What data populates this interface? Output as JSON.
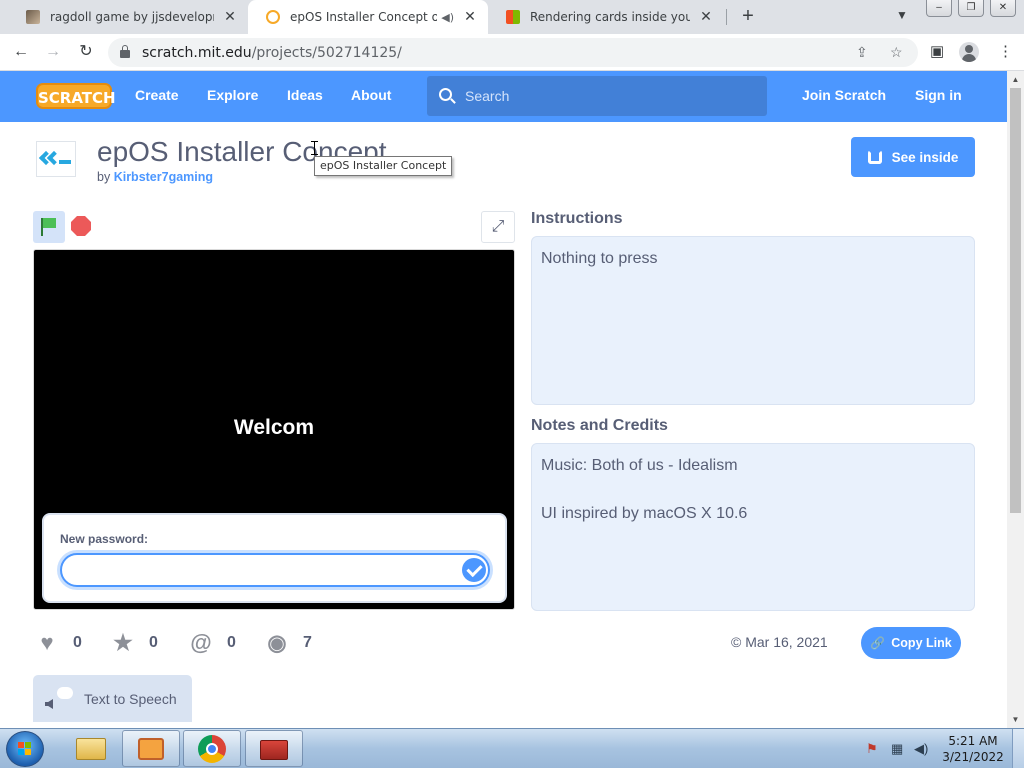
{
  "browser": {
    "tabs": [
      {
        "title": "ragdoll game by jjsdevelopments",
        "active": false
      },
      {
        "title": "epOS Installer Concept on Scratch",
        "active": true
      },
      {
        "title": "Rendering cards inside your app",
        "active": false
      }
    ],
    "url_domain": "scratch.mit.edu",
    "url_path": "/projects/502714125/"
  },
  "nav": {
    "logo": "SCRATCH",
    "links": [
      "Create",
      "Explore",
      "Ideas",
      "About"
    ],
    "search_placeholder": "Search",
    "join": "Join Scratch",
    "signin": "Sign in"
  },
  "project": {
    "title": "epOS Installer Concept",
    "by_prefix": "by",
    "author": "Kirbster7gaming",
    "tooltip": "epOS Installer Concept",
    "see_inside": "See inside"
  },
  "stage": {
    "text": "Welcom",
    "ask_label": "New password:",
    "ask_value": ""
  },
  "instructions": {
    "heading": "Instructions",
    "text": "Nothing to press"
  },
  "notes": {
    "heading": "Notes and Credits",
    "line1": "Music: Both of us - Idealism",
    "line2": "UI inspired by macOS X 10.6"
  },
  "stats": {
    "loves": "0",
    "favorites": "0",
    "remixes": "0",
    "views": "7",
    "date": "© Mar 16, 2021",
    "copy_link": "Copy Link"
  },
  "tts": {
    "label": "Text to Speech"
  },
  "taskbar": {
    "time": "5:21 AM",
    "date": "3/21/2022"
  },
  "colors": {
    "scratch_blue": "#4c97ff",
    "stage_bg": "#000000",
    "text": "#575e75"
  }
}
